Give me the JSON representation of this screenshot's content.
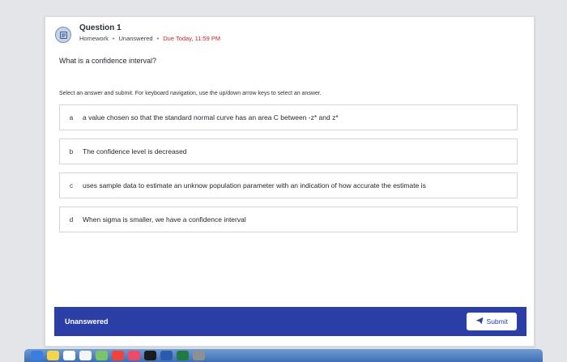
{
  "question": {
    "title": "Question 1",
    "type": "Homework",
    "status": "Unanswered",
    "due": "Due Today, 11:59 PM",
    "text": "What is a confidence interval?",
    "instructions": "Select an answer and submit. For keyboard navigation, use the up/down arrow keys to select an answer."
  },
  "options": [
    {
      "letter": "a",
      "text": "a value chosen so that the standard normal curve has an area C between -z* and z*"
    },
    {
      "letter": "b",
      "text": "The confidence level is decreased"
    },
    {
      "letter": "c",
      "text": "uses sample data to estimate an unknow population parameter with an indication of how accurate the estimate is"
    },
    {
      "letter": "d",
      "text": "When sigma is smaller, we have a confidence interval"
    }
  ],
  "footer": {
    "status": "Unanswered",
    "submit_label": "Submit"
  },
  "colors": {
    "footer_bg": "#2a3ea6",
    "due_text": "#c6262b"
  },
  "dock": {
    "icons": [
      "app-store-icon",
      "notes-icon",
      "photos-icon",
      "calendar-icon",
      "maps-icon",
      "news-icon",
      "music-icon",
      "tv-icon",
      "word-icon",
      "excel-icon",
      "settings-icon"
    ]
  }
}
